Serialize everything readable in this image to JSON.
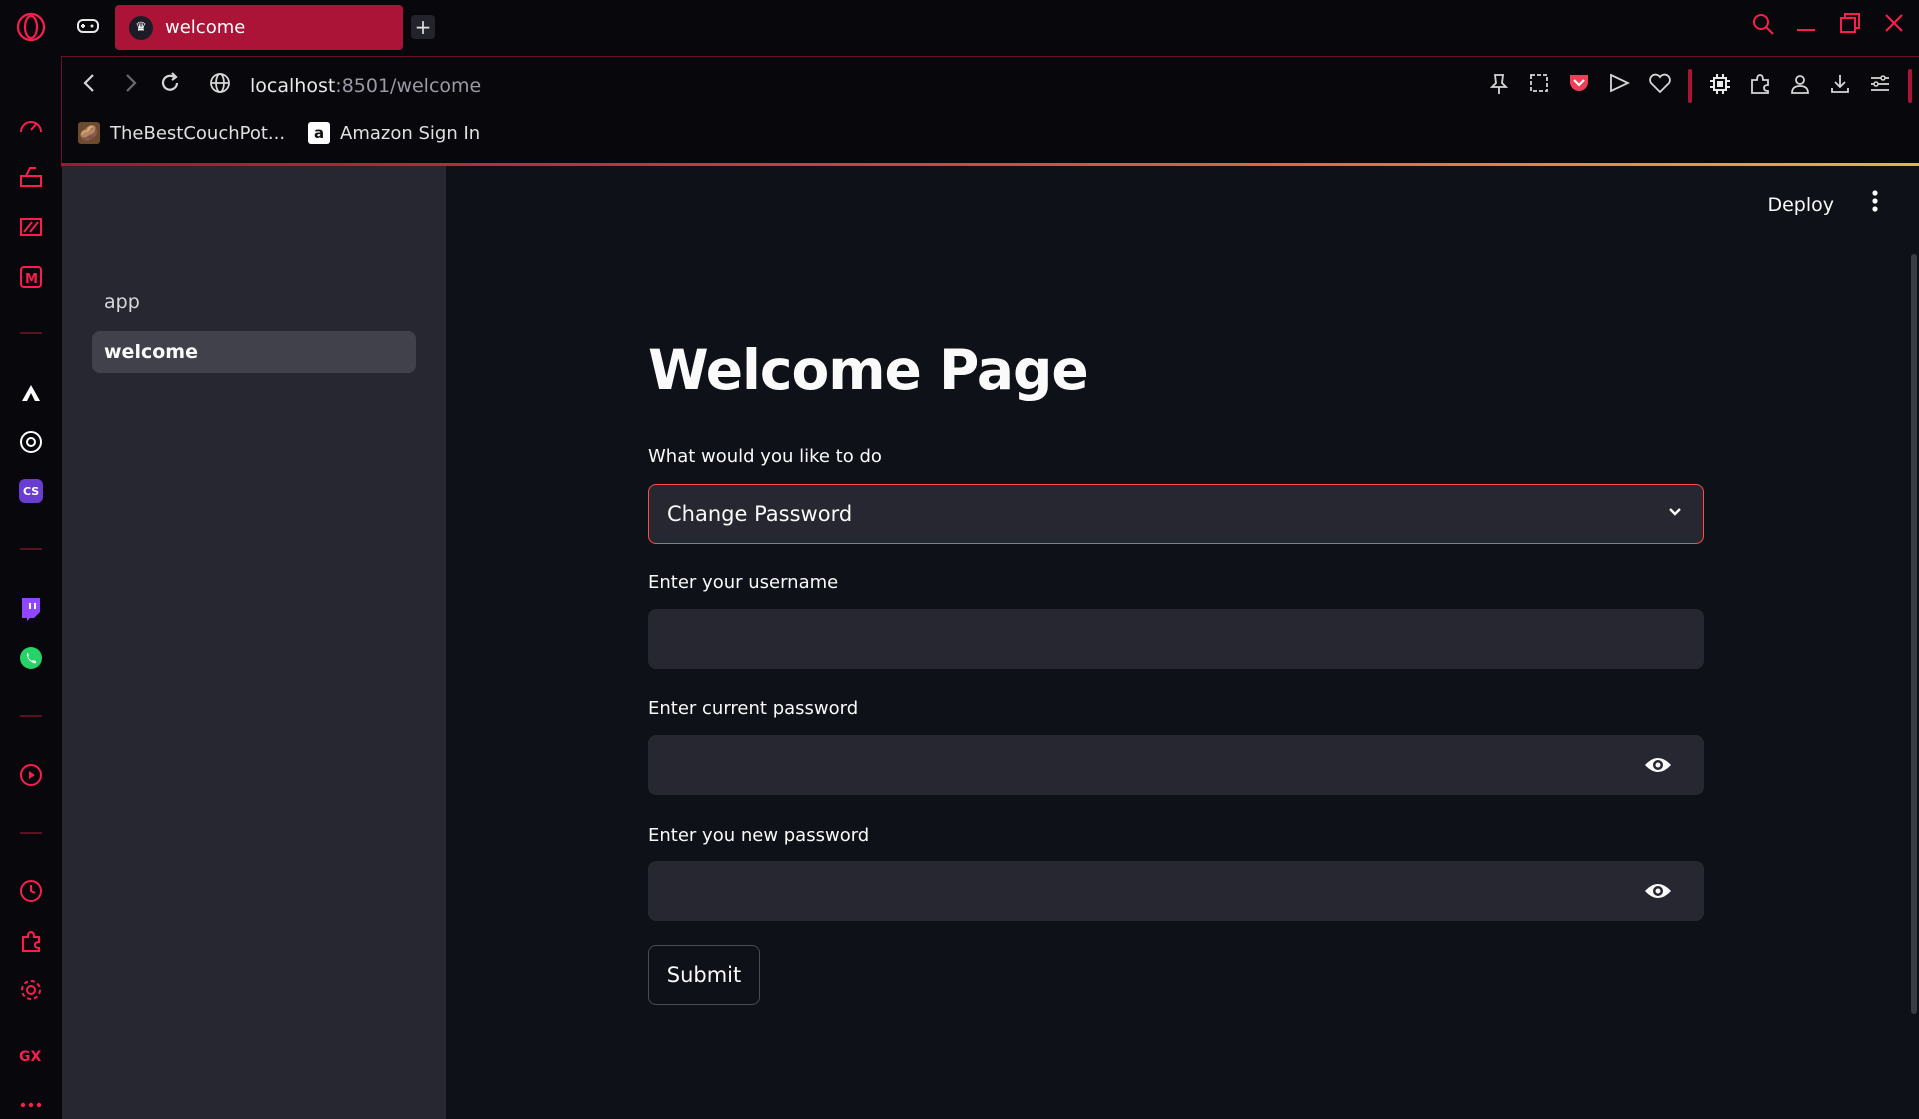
{
  "browser": {
    "tab_title": "welcome",
    "tab_favicon": "crown-icon",
    "url_host": "localhost",
    "url_path": ":8501/welcome",
    "bookmarks": [
      {
        "label": "TheBestCouchPot...",
        "icon": "couch-potato-icon"
      },
      {
        "label": "Amazon Sign In",
        "icon": "amazon-icon"
      }
    ],
    "accent_color": "#fa1e4e"
  },
  "sidebar": {
    "items": [
      {
        "label": "app",
        "active": false
      },
      {
        "label": "welcome",
        "active": true
      }
    ]
  },
  "header": {
    "deploy_label": "Deploy"
  },
  "main": {
    "title": "Welcome Page",
    "action_label": "What would you like to do",
    "action_value": "Change Password",
    "username_label": "Enter your username",
    "username_value": "",
    "current_password_label": "Enter current password",
    "current_password_value": "",
    "new_password_label": "Enter you new password",
    "new_password_value": "",
    "submit_label": "Submit"
  }
}
